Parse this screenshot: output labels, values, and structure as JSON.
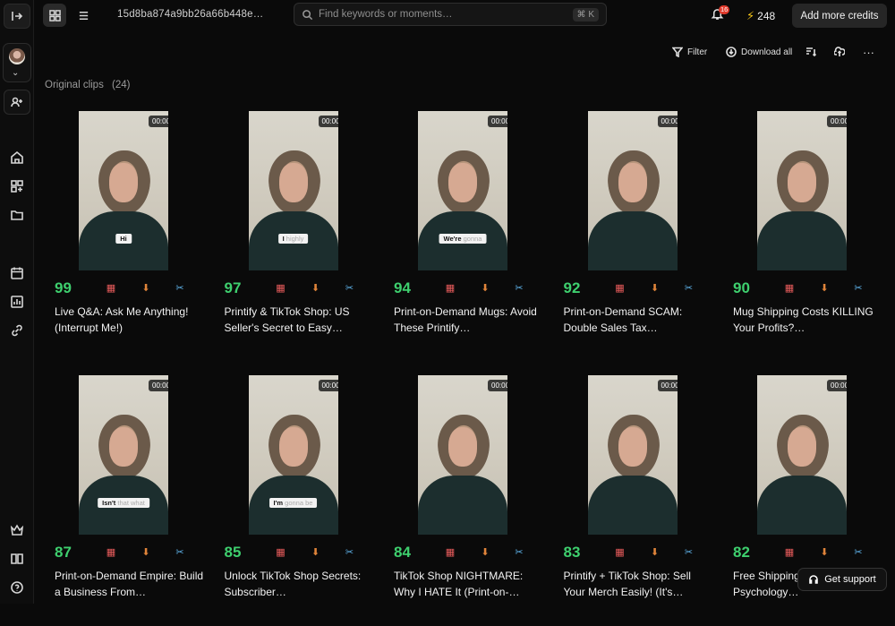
{
  "header": {
    "project_id": "15d8ba874a9bb26a66b448e…",
    "search_placeholder": "Find keywords or moments…",
    "search_shortcut": "⌘ K",
    "notification_count": "16",
    "credits": "248",
    "add_credits_label": "Add more credits"
  },
  "toolbar": {
    "filter_label": "Filter",
    "download_all_label": "Download all"
  },
  "section": {
    "title": "Original clips",
    "count": "(24)"
  },
  "clips": [
    {
      "score": "99",
      "start": "00:00",
      "duration": "00:19",
      "subtitle_bold": "Hi",
      "subtitle_rest": "",
      "title": "Live Q&A: Ask Me Anything! (Interrupt Me!)"
    },
    {
      "score": "97",
      "start": "00:00",
      "duration": "00:25",
      "subtitle_bold": "I",
      "subtitle_rest": "highly",
      "title": "Printify & TikTok Shop: US Seller's Secret to Easy…"
    },
    {
      "score": "94",
      "start": "00:00",
      "duration": "01:25",
      "subtitle_bold": "We're",
      "subtitle_rest": "gonna",
      "title": "Print-on-Demand Mugs: Avoid These Printify…"
    },
    {
      "score": "92",
      "start": "00:00",
      "duration": "00:30",
      "subtitle_bold": "",
      "subtitle_rest": "",
      "title": "Print-on-Demand SCAM: Double Sales Tax…"
    },
    {
      "score": "90",
      "start": "00:00",
      "duration": "01:24",
      "subtitle_bold": "",
      "subtitle_rest": "",
      "title": "Mug Shipping Costs KILLING Your Profits?…"
    },
    {
      "score": "87",
      "start": "00:00",
      "duration": "00:15",
      "subtitle_bold": "Isn't",
      "subtitle_rest": "that what",
      "title": "Print-on-Demand Empire: Build a Business From…"
    },
    {
      "score": "85",
      "start": "00:00",
      "duration": "00:49",
      "subtitle_bold": "I'm",
      "subtitle_rest": "gonna be",
      "title": "Unlock TikTok Shop Secrets: Subscriber…"
    },
    {
      "score": "84",
      "start": "00:00",
      "duration": "00:39",
      "subtitle_bold": "",
      "subtitle_rest": "",
      "title": "TikTok Shop NIGHTMARE: Why I HATE It (Print-on-…"
    },
    {
      "score": "83",
      "start": "00:00",
      "duration": "00:37",
      "subtitle_bold": "",
      "subtitle_rest": "",
      "title": "Printify + TikTok Shop: Sell Your Merch Easily! (It's…"
    },
    {
      "score": "82",
      "start": "00:00",
      "duration": "00:18",
      "subtitle_bold": "",
      "subtitle_rest": "",
      "title": "Free Shipping Costs: Pricing Psychology…"
    }
  ],
  "support_label": "Get support",
  "colors": {
    "score_green": "#3ecf6e",
    "calendar_red": "#e85c5c",
    "download_orange": "#e0843a",
    "scissors_blue": "#5fb3ea",
    "credit_bolt": "#f5c518"
  },
  "icons": [
    "collapse-sidebar-icon",
    "grid-view-icon",
    "list-view-icon",
    "search-icon",
    "bell-icon",
    "bolt-icon",
    "filter-icon",
    "download-icon",
    "sort-icon",
    "upload-icon",
    "more-icon",
    "home-icon",
    "add-apps-icon",
    "folder-icon",
    "calendar-icon",
    "analytics-icon",
    "link-icon",
    "crown-icon",
    "book-icon",
    "help-icon",
    "scissors-icon",
    "headset-icon"
  ]
}
